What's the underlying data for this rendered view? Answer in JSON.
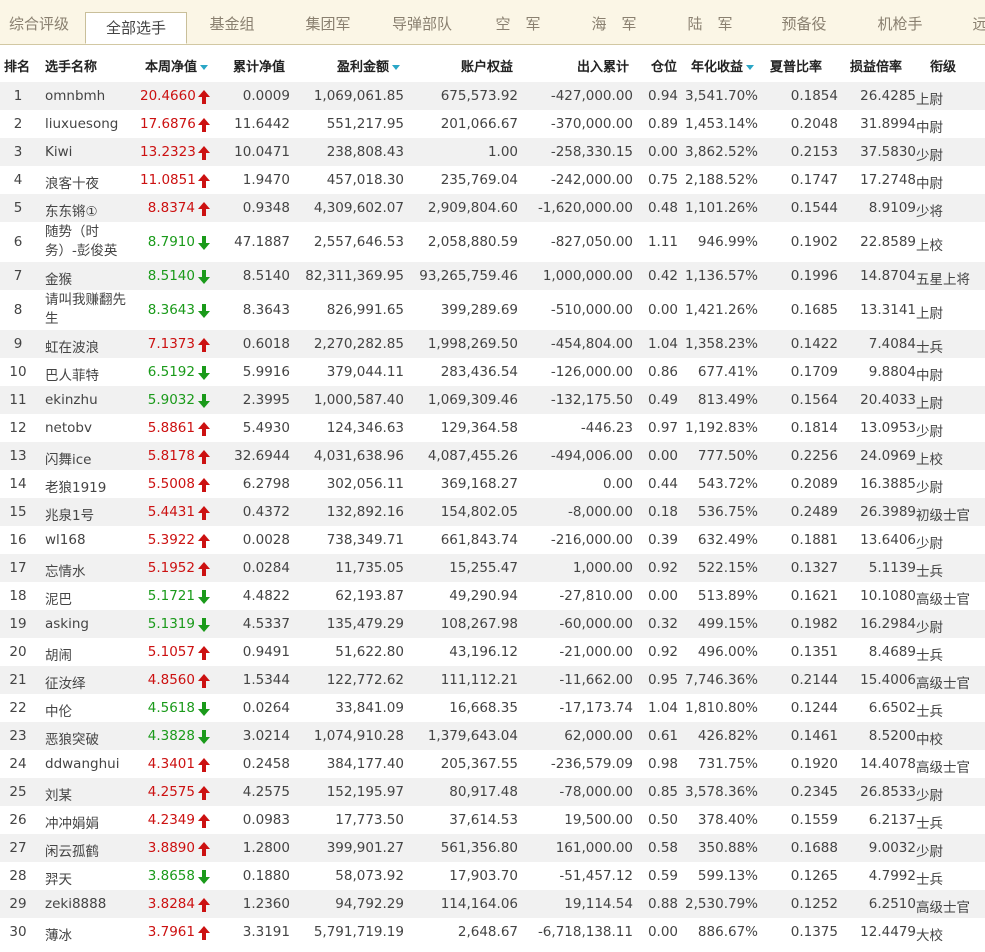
{
  "tabs": [
    {
      "label": "综合评级"
    },
    {
      "label": "全部选手",
      "active": true
    },
    {
      "label": "基金组"
    },
    {
      "label": "集团军"
    },
    {
      "label": "导弹部队"
    },
    {
      "label": "空　军"
    },
    {
      "label": "海　军"
    },
    {
      "label": "陆　军"
    },
    {
      "label": "预备役"
    },
    {
      "label": "机枪手"
    },
    {
      "label": "远"
    }
  ],
  "colors": {
    "up": "#cc1111",
    "down": "#1a9a1a",
    "sort_icon": "#2aa6c6",
    "tab_bar": "#fbf6e6",
    "stripe": "#f1f1f1"
  },
  "icons": {
    "up": "up-arrow-icon",
    "down": "down-arrow-icon",
    "sort": "sort-caret-icon"
  },
  "columns": [
    {
      "key": "rank",
      "label": "排名"
    },
    {
      "key": "name",
      "label": "选手名称"
    },
    {
      "key": "week_nav",
      "label": "本周净值",
      "sortable": true
    },
    {
      "key": "cum_nav",
      "label": "累计净值"
    },
    {
      "key": "profit",
      "label": "盈利金额",
      "sortable": true
    },
    {
      "key": "equity",
      "label": "账户权益"
    },
    {
      "key": "inout",
      "label": "出入累计"
    },
    {
      "key": "position",
      "label": "仓位"
    },
    {
      "key": "annual",
      "label": "年化收益",
      "sortable": true
    },
    {
      "key": "sharpe",
      "label": "夏普比率"
    },
    {
      "key": "pl_ratio",
      "label": "损益倍率"
    },
    {
      "key": "rank_title",
      "label": "衔级"
    }
  ],
  "rows": [
    {
      "rank": "1",
      "name": "omnbmh",
      "week_nav": "20.4660",
      "trend": "up",
      "cum_nav": "0.0009",
      "profit": "1,069,061.85",
      "equity": "675,573.92",
      "inout": "-427,000.00",
      "position": "0.94",
      "annual": "3,541.70%",
      "sharpe": "0.1854",
      "pl_ratio": "26.4285",
      "title": "上尉"
    },
    {
      "rank": "2",
      "name": "liuxuesong",
      "week_nav": "17.6876",
      "trend": "up",
      "cum_nav": "11.6442",
      "profit": "551,217.95",
      "equity": "201,066.67",
      "inout": "-370,000.00",
      "position": "0.89",
      "annual": "1,453.14%",
      "sharpe": "0.2048",
      "pl_ratio": "31.8994",
      "title": "中尉"
    },
    {
      "rank": "3",
      "name": "Kiwi",
      "week_nav": "13.2323",
      "trend": "up",
      "cum_nav": "10.0471",
      "profit": "238,808.43",
      "equity": "1.00",
      "inout": "-258,330.15",
      "position": "0.00",
      "annual": "3,862.52%",
      "sharpe": "0.2153",
      "pl_ratio": "37.5830",
      "title": "少尉"
    },
    {
      "rank": "4",
      "name": "浪客十夜",
      "week_nav": "11.0851",
      "trend": "up",
      "cum_nav": "1.9470",
      "profit": "457,018.30",
      "equity": "235,769.04",
      "inout": "-242,000.00",
      "position": "0.75",
      "annual": "2,188.52%",
      "sharpe": "0.1747",
      "pl_ratio": "17.2748",
      "title": "中尉"
    },
    {
      "rank": "5",
      "name": "东东锵①",
      "week_nav": "8.8374",
      "trend": "up",
      "cum_nav": "0.9348",
      "profit": "4,309,602.07",
      "equity": "2,909,804.60",
      "inout": "-1,620,000.00",
      "position": "0.48",
      "annual": "1,101.26%",
      "sharpe": "0.1544",
      "pl_ratio": "8.9109",
      "title": "少将"
    },
    {
      "rank": "6",
      "name": "随势（时务）-彭俊英",
      "week_nav": "8.7910",
      "trend": "down",
      "cum_nav": "47.1887",
      "profit": "2,557,646.53",
      "equity": "2,058,880.59",
      "inout": "-827,050.00",
      "position": "1.11",
      "annual": "946.99%",
      "sharpe": "0.1902",
      "pl_ratio": "22.8589",
      "title": "上校"
    },
    {
      "rank": "7",
      "name": "金猴",
      "week_nav": "8.5140",
      "trend": "down",
      "cum_nav": "8.5140",
      "profit": "82,311,369.95",
      "equity": "93,265,759.46",
      "inout": "1,000,000.00",
      "position": "0.42",
      "annual": "1,136.57%",
      "sharpe": "0.1996",
      "pl_ratio": "14.8704",
      "title": "五星上将"
    },
    {
      "rank": "8",
      "name": "请叫我赚翻先生",
      "week_nav": "8.3643",
      "trend": "down",
      "cum_nav": "8.3643",
      "profit": "826,991.65",
      "equity": "399,289.69",
      "inout": "-510,000.00",
      "position": "0.00",
      "annual": "1,421.26%",
      "sharpe": "0.1685",
      "pl_ratio": "13.3141",
      "title": "上尉"
    },
    {
      "rank": "9",
      "name": "虹在波浪",
      "week_nav": "7.1373",
      "trend": "up",
      "cum_nav": "0.6018",
      "profit": "2,270,282.85",
      "equity": "1,998,269.50",
      "inout": "-454,804.00",
      "position": "1.04",
      "annual": "1,358.23%",
      "sharpe": "0.1422",
      "pl_ratio": "7.4084",
      "title": "士兵"
    },
    {
      "rank": "10",
      "name": "巴人菲特",
      "week_nav": "6.5192",
      "trend": "down",
      "cum_nav": "5.9916",
      "profit": "379,044.11",
      "equity": "283,436.54",
      "inout": "-126,000.00",
      "position": "0.86",
      "annual": "677.41%",
      "sharpe": "0.1709",
      "pl_ratio": "9.8804",
      "title": "中尉"
    },
    {
      "rank": "11",
      "name": "ekinzhu",
      "week_nav": "5.9032",
      "trend": "down",
      "cum_nav": "2.3995",
      "profit": "1,000,587.40",
      "equity": "1,069,309.46",
      "inout": "-132,175.50",
      "position": "0.49",
      "annual": "813.49%",
      "sharpe": "0.1564",
      "pl_ratio": "20.4033",
      "title": "上尉"
    },
    {
      "rank": "12",
      "name": "netobv",
      "week_nav": "5.8861",
      "trend": "up",
      "cum_nav": "5.4930",
      "profit": "124,346.63",
      "equity": "129,364.58",
      "inout": "-446.23",
      "position": "0.97",
      "annual": "1,192.83%",
      "sharpe": "0.1814",
      "pl_ratio": "13.0953",
      "title": "少尉"
    },
    {
      "rank": "13",
      "name": "闪舞ice",
      "week_nav": "5.8178",
      "trend": "up",
      "cum_nav": "32.6944",
      "profit": "4,031,638.96",
      "equity": "4,087,455.26",
      "inout": "-494,006.00",
      "position": "0.00",
      "annual": "777.50%",
      "sharpe": "0.2256",
      "pl_ratio": "24.0969",
      "title": "上校"
    },
    {
      "rank": "14",
      "name": "老狼1919",
      "week_nav": "5.5008",
      "trend": "up",
      "cum_nav": "6.2798",
      "profit": "302,056.11",
      "equity": "369,168.27",
      "inout": "0.00",
      "position": "0.44",
      "annual": "543.72%",
      "sharpe": "0.2089",
      "pl_ratio": "16.3885",
      "title": "少尉"
    },
    {
      "rank": "15",
      "name": "兆泉1号",
      "week_nav": "5.4431",
      "trend": "up",
      "cum_nav": "0.4372",
      "profit": "132,892.16",
      "equity": "154,802.05",
      "inout": "-8,000.00",
      "position": "0.18",
      "annual": "536.75%",
      "sharpe": "0.2489",
      "pl_ratio": "26.3989",
      "title": "初级士官"
    },
    {
      "rank": "16",
      "name": "wl168",
      "week_nav": "5.3922",
      "trend": "up",
      "cum_nav": "0.0028",
      "profit": "738,349.71",
      "equity": "661,843.74",
      "inout": "-216,000.00",
      "position": "0.39",
      "annual": "632.49%",
      "sharpe": "0.1881",
      "pl_ratio": "13.6406",
      "title": "少尉"
    },
    {
      "rank": "17",
      "name": "忘情水",
      "week_nav": "5.1952",
      "trend": "up",
      "cum_nav": "0.0284",
      "profit": "11,735.05",
      "equity": "15,255.47",
      "inout": "1,000.00",
      "position": "0.92",
      "annual": "522.15%",
      "sharpe": "0.1327",
      "pl_ratio": "5.1139",
      "title": "士兵"
    },
    {
      "rank": "18",
      "name": "泥巴",
      "week_nav": "5.1721",
      "trend": "down",
      "cum_nav": "4.4822",
      "profit": "62,193.87",
      "equity": "49,290.94",
      "inout": "-27,810.00",
      "position": "0.00",
      "annual": "513.89%",
      "sharpe": "0.1621",
      "pl_ratio": "10.1080",
      "title": "高级士官"
    },
    {
      "rank": "19",
      "name": "asking",
      "week_nav": "5.1319",
      "trend": "down",
      "cum_nav": "4.5337",
      "profit": "135,479.29",
      "equity": "108,267.98",
      "inout": "-60,000.00",
      "position": "0.32",
      "annual": "499.15%",
      "sharpe": "0.1982",
      "pl_ratio": "16.2984",
      "title": "少尉"
    },
    {
      "rank": "20",
      "name": "胡闹",
      "week_nav": "5.1057",
      "trend": "up",
      "cum_nav": "0.9491",
      "profit": "51,622.80",
      "equity": "43,196.12",
      "inout": "-21,000.00",
      "position": "0.92",
      "annual": "496.00%",
      "sharpe": "0.1351",
      "pl_ratio": "8.4689",
      "title": "士兵"
    },
    {
      "rank": "21",
      "name": "征汝绎",
      "week_nav": "4.8560",
      "trend": "up",
      "cum_nav": "1.5344",
      "profit": "122,772.62",
      "equity": "111,112.21",
      "inout": "-11,662.00",
      "position": "0.95",
      "annual": "7,746.36%",
      "sharpe": "0.2144",
      "pl_ratio": "15.4006",
      "title": "高级士官"
    },
    {
      "rank": "22",
      "name": "中伦",
      "week_nav": "4.5618",
      "trend": "down",
      "cum_nav": "0.0264",
      "profit": "33,841.09",
      "equity": "16,668.35",
      "inout": "-17,173.74",
      "position": "1.04",
      "annual": "1,810.80%",
      "sharpe": "0.1244",
      "pl_ratio": "6.6502",
      "title": "士兵"
    },
    {
      "rank": "23",
      "name": "恶狼突破",
      "week_nav": "4.3828",
      "trend": "down",
      "cum_nav": "3.0214",
      "profit": "1,074,910.28",
      "equity": "1,379,643.04",
      "inout": "62,000.00",
      "position": "0.61",
      "annual": "426.82%",
      "sharpe": "0.1461",
      "pl_ratio": "8.5200",
      "title": "中校"
    },
    {
      "rank": "24",
      "name": "ddwanghui",
      "week_nav": "4.3401",
      "trend": "up",
      "cum_nav": "0.2458",
      "profit": "384,177.40",
      "equity": "205,367.55",
      "inout": "-236,579.09",
      "position": "0.98",
      "annual": "731.75%",
      "sharpe": "0.1920",
      "pl_ratio": "14.4078",
      "title": "高级士官"
    },
    {
      "rank": "25",
      "name": "刘某",
      "week_nav": "4.2575",
      "trend": "up",
      "cum_nav": "4.2575",
      "profit": "152,195.97",
      "equity": "80,917.48",
      "inout": "-78,000.00",
      "position": "0.85",
      "annual": "3,578.36%",
      "sharpe": "0.2345",
      "pl_ratio": "26.8533",
      "title": "少尉"
    },
    {
      "rank": "26",
      "name": "冲冲娟娟",
      "week_nav": "4.2349",
      "trend": "up",
      "cum_nav": "0.0983",
      "profit": "17,773.50",
      "equity": "37,614.53",
      "inout": "19,500.00",
      "position": "0.50",
      "annual": "378.40%",
      "sharpe": "0.1559",
      "pl_ratio": "6.2137",
      "title": "士兵"
    },
    {
      "rank": "27",
      "name": "闲云孤鹤",
      "week_nav": "3.8890",
      "trend": "up",
      "cum_nav": "1.2800",
      "profit": "399,901.27",
      "equity": "561,356.80",
      "inout": "161,000.00",
      "position": "0.58",
      "annual": "350.88%",
      "sharpe": "0.1688",
      "pl_ratio": "9.0032",
      "title": "少尉"
    },
    {
      "rank": "28",
      "name": "羿天",
      "week_nav": "3.8658",
      "trend": "down",
      "cum_nav": "0.1880",
      "profit": "58,073.92",
      "equity": "17,903.70",
      "inout": "-51,457.12",
      "position": "0.59",
      "annual": "599.13%",
      "sharpe": "0.1265",
      "pl_ratio": "4.7992",
      "title": "士兵"
    },
    {
      "rank": "29",
      "name": "zeki8888",
      "week_nav": "3.8284",
      "trend": "up",
      "cum_nav": "1.2360",
      "profit": "94,792.29",
      "equity": "114,164.06",
      "inout": "19,114.54",
      "position": "0.88",
      "annual": "2,530.79%",
      "sharpe": "0.1252",
      "pl_ratio": "6.2510",
      "title": "高级士官"
    },
    {
      "rank": "30",
      "name": "薄冰",
      "week_nav": "3.7961",
      "trend": "up",
      "cum_nav": "3.3191",
      "profit": "5,791,719.19",
      "equity": "2,648.67",
      "inout": "-6,718,138.11",
      "position": "0.00",
      "annual": "886.67%",
      "sharpe": "0.1375",
      "pl_ratio": "12.4479",
      "title": "大校"
    }
  ]
}
